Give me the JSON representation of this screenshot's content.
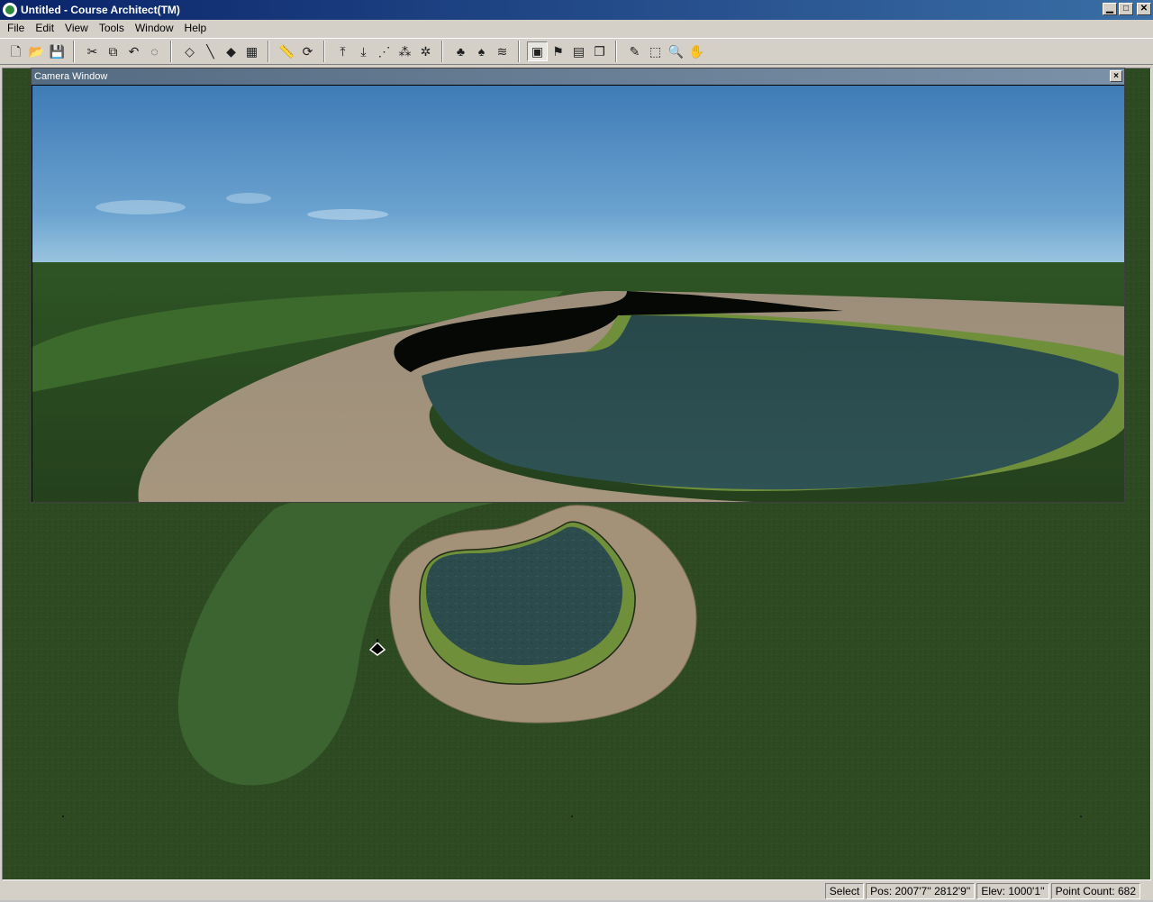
{
  "window": {
    "title": "Untitled - Course Architect(TM)",
    "buttons": {
      "minimize": "0",
      "maximize": "1",
      "close": "r"
    }
  },
  "menu": [
    "File",
    "Edit",
    "View",
    "Tools",
    "Window",
    "Help"
  ],
  "toolbar": {
    "groups": [
      [
        {
          "name": "new-icon",
          "glyph": "🗋"
        },
        {
          "name": "open-icon",
          "glyph": "📂"
        },
        {
          "name": "save-icon",
          "glyph": "💾"
        }
      ],
      [
        {
          "name": "cut-icon",
          "glyph": "✂"
        },
        {
          "name": "copy-icon",
          "glyph": "⧉"
        },
        {
          "name": "undo-icon",
          "glyph": "↶"
        },
        {
          "name": "lasso-icon",
          "glyph": "◌"
        }
      ],
      [
        {
          "name": "select-point-icon",
          "glyph": "◇"
        },
        {
          "name": "draw-line-icon",
          "glyph": "╲"
        },
        {
          "name": "shape-icon",
          "glyph": "◆"
        },
        {
          "name": "stamp-icon",
          "glyph": "▦"
        }
      ],
      [
        {
          "name": "measure-icon",
          "glyph": "📏"
        },
        {
          "name": "rotate-icon",
          "glyph": "⟳"
        }
      ],
      [
        {
          "name": "raise-icon",
          "glyph": "⤒"
        },
        {
          "name": "lower-icon",
          "glyph": "⤓"
        },
        {
          "name": "smooth-icon",
          "glyph": "⋰"
        },
        {
          "name": "scatter-icon",
          "glyph": "⁂"
        },
        {
          "name": "plant-icon",
          "glyph": "✲"
        }
      ],
      [
        {
          "name": "trees-icon",
          "glyph": "♣"
        },
        {
          "name": "tree-icon",
          "glyph": "♠"
        },
        {
          "name": "path-icon",
          "glyph": "≋"
        }
      ],
      [
        {
          "name": "camera-icon",
          "glyph": "▣",
          "pressed": true
        },
        {
          "name": "hole-icon",
          "glyph": "⚑"
        },
        {
          "name": "film-icon",
          "glyph": "▤"
        },
        {
          "name": "window-icon",
          "glyph": "❐"
        }
      ],
      [
        {
          "name": "eyedropper-icon",
          "glyph": "✎"
        },
        {
          "name": "zoom-box-icon",
          "glyph": "⬚"
        },
        {
          "name": "zoom-icon",
          "glyph": "🔍"
        },
        {
          "name": "pan-hand-icon",
          "glyph": "✋"
        }
      ]
    ]
  },
  "camera_window": {
    "title": "Camera Window",
    "close": "×"
  },
  "statusbar": {
    "mode": "Select",
    "pos": "Pos: 2007'7'' 2812'9''",
    "elev": "Elev: 1000'1''",
    "point_count": "Point Count:  682"
  },
  "colors": {
    "rough": "#2d4a22",
    "fairway": "#3f6b2e",
    "sand": "#a39178",
    "water": "#2c4d4e",
    "bank": "#6f8f3a",
    "sky_top": "#3f7bb6",
    "sky_bottom": "#9cc6e0"
  }
}
